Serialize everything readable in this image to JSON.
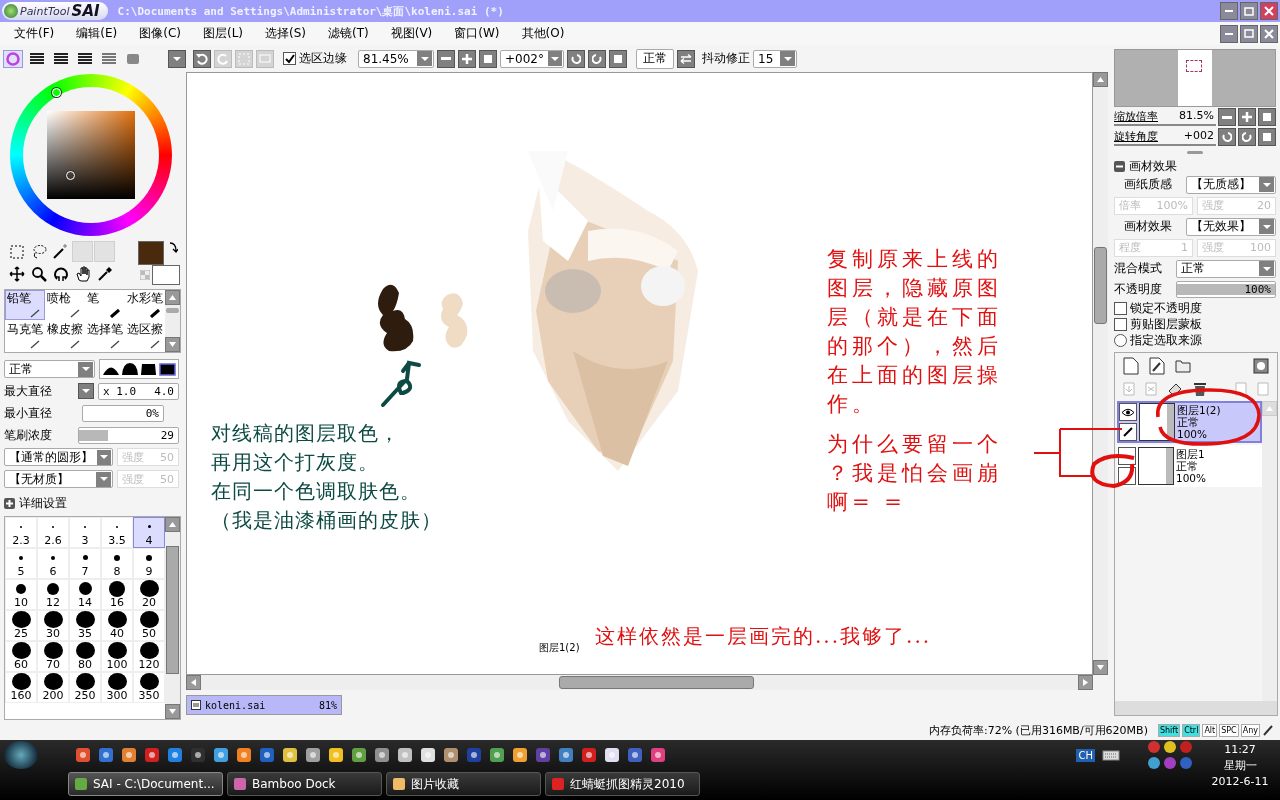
{
  "window": {
    "logo_text": "PaintTool",
    "logo_mark": "SAI",
    "title": "C:\\Documents and Settings\\Administrator\\桌面\\koleni.sai (*)"
  },
  "menu": [
    "文件(F)",
    "编辑(E)",
    "图像(C)",
    "图层(L)",
    "选择(S)",
    "滤镜(T)",
    "视图(V)",
    "窗口(W)",
    "其他(O)"
  ],
  "color_modes": [
    {
      "selected": true
    },
    {
      "selected": false
    },
    {
      "selected": false
    },
    {
      "selected": false
    },
    {
      "selected": false
    },
    {
      "selected": false
    }
  ],
  "toolbar": {
    "selection_edge": {
      "label": "选区边缘",
      "checked": true
    },
    "zoom": "81.45%",
    "angle": "+002°",
    "blend": "正常",
    "stabilizer_label": "抖动修正",
    "stabilizer": "15"
  },
  "brushes": [
    {
      "label": "铅笔",
      "selected": true
    },
    {
      "label": "喷枪",
      "selected": false
    },
    {
      "label": "笔",
      "selected": false
    },
    {
      "label": "水彩笔",
      "selected": false
    },
    {
      "label": "马克笔",
      "selected": false
    },
    {
      "label": "橡皮擦",
      "selected": false
    },
    {
      "label": "选择笔",
      "selected": false
    },
    {
      "label": "选区擦",
      "selected": false
    }
  ],
  "brush_settings": {
    "mode": "正常",
    "max_label": "最大直径",
    "max_scale": "x 1.0",
    "max_value": "4.0",
    "min_label": "最小直径",
    "min_value": "0%",
    "density_label": "笔刷浓度",
    "density": {
      "value": "29",
      "level": 0.29
    },
    "shape": "【通常的圆形】",
    "texture": "【无材质】",
    "shape_strength": {
      "label": "强度",
      "value": "50",
      "disabled": true
    },
    "texture_strength": {
      "label": "强度",
      "value": "50",
      "disabled": true
    },
    "detail_label": "详细设置"
  },
  "sizes": [
    {
      "label": "2.3",
      "selected": false
    },
    {
      "label": "2.6",
      "selected": false
    },
    {
      "label": "3",
      "selected": false
    },
    {
      "label": "3.5",
      "selected": false
    },
    {
      "label": "4",
      "selected": true
    },
    {
      "label": "5",
      "selected": false
    },
    {
      "label": "6",
      "selected": false
    },
    {
      "label": "7",
      "selected": false
    },
    {
      "label": "8",
      "selected": false
    },
    {
      "label": "9",
      "selected": false
    },
    {
      "label": "10",
      "selected": false
    },
    {
      "label": "12",
      "selected": false
    },
    {
      "label": "14",
      "selected": false
    },
    {
      "label": "16",
      "selected": false
    },
    {
      "label": "20",
      "selected": false
    },
    {
      "label": "25",
      "selected": false
    },
    {
      "label": "30",
      "selected": false
    },
    {
      "label": "35",
      "selected": false
    },
    {
      "label": "40",
      "selected": false
    },
    {
      "label": "50",
      "selected": false
    },
    {
      "label": "60",
      "selected": false
    },
    {
      "label": "70",
      "selected": false
    },
    {
      "label": "80",
      "selected": false
    },
    {
      "label": "100",
      "selected": false
    },
    {
      "label": "120",
      "selected": false
    },
    {
      "label": "160",
      "selected": false
    },
    {
      "label": "200",
      "selected": false
    },
    {
      "label": "250",
      "selected": false
    },
    {
      "label": "300",
      "selected": false
    },
    {
      "label": "350",
      "selected": false
    }
  ],
  "canvas": {
    "notes": [
      {
        "lines": [
          "对线稿的图层取色，",
          "再用这个打灰度。",
          "在同一个色调取肤色。",
          "（我是油漆桶画的皮肤）"
        ],
        "color": "#0e4a44"
      },
      {
        "lines": [
          "复制原来上线的",
          "图层，隐藏原图",
          "层（就是在下面",
          "的那个），然后",
          "在上面的图层操",
          "作。"
        ],
        "color": "#e01010"
      },
      {
        "lines": [
          "为什么要留一个",
          "？我是怕会画崩",
          "啊= ="
        ],
        "color": "#e01010"
      }
    ],
    "layer_label": "图层1(2)",
    "footer_note": {
      "text": "这样依然是一层画完的...我够了...",
      "color": "#e01010"
    }
  },
  "document_tabs": [
    {
      "name": "koleni.sai",
      "zoom": "81%",
      "selected": true
    }
  ],
  "navigator": {
    "zoom_label": "缩放倍率",
    "zoom": "81.5%",
    "angle_label": "旋转角度",
    "angle": "+002"
  },
  "material": {
    "title": "画材效果",
    "expanded": true,
    "paper_label": "画纸质感",
    "paper": "【无质感】",
    "paper_fields": [
      {
        "label": "倍率",
        "value": "100%",
        "disabled": true
      },
      {
        "label": "强度",
        "value": "20",
        "disabled": true
      }
    ],
    "effect_label": "画材效果",
    "effect": "【无效果】",
    "effect_fields": [
      {
        "label": "程度",
        "value": "1",
        "disabled": true
      },
      {
        "label": "强度",
        "value": "100",
        "disabled": true
      }
    ]
  },
  "layer_props": {
    "blend_label": "混合模式",
    "blend": "正常",
    "opacity_label": "不透明度",
    "opacity": {
      "value": "100%",
      "level": 1
    },
    "options": [
      {
        "kind": "checkbox",
        "label": "锁定不透明度",
        "checked": false
      },
      {
        "kind": "checkbox",
        "label": "剪贴图层蒙板",
        "checked": false
      },
      {
        "kind": "radio",
        "label": "指定选取来源",
        "checked": false
      }
    ]
  },
  "layers": [
    {
      "name": "图层1(2)",
      "mode": "正常",
      "opacity": "100%",
      "visible": true,
      "selected": true
    },
    {
      "name": "图层1",
      "mode": "正常",
      "opacity": "100%",
      "visible": false,
      "selected": false
    }
  ],
  "status": {
    "memory": "内存负荷率:72% (已用316MB/可用620MB)",
    "keys": [
      {
        "label": "Shift",
        "on": true
      },
      {
        "label": "Ctrl",
        "on": true
      },
      {
        "label": "Alt",
        "on": false
      },
      {
        "label": "SPC",
        "on": false
      },
      {
        "label": "Any",
        "on": false
      }
    ]
  },
  "taskbar": {
    "tasks": [
      {
        "label": "SAI - C:\\Document...",
        "selected": true
      },
      {
        "label": "Bamboo Dock",
        "selected": false
      },
      {
        "label": "图片收藏",
        "selected": false
      },
      {
        "label": "红蜻蜓抓图精灵2010",
        "selected": false
      }
    ],
    "language": "CH",
    "time": "11:27",
    "weekday": "星期一",
    "date": "2012-6-11"
  }
}
